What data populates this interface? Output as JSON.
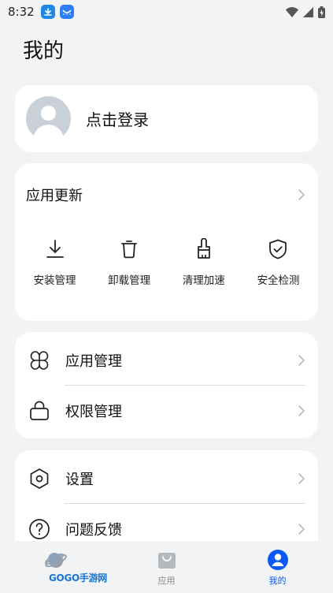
{
  "status_bar": {
    "time": "8:32",
    "icons": [
      "download-notification-icon",
      "app-store-notification-icon",
      "wifi-icon",
      "signal-icon",
      "battery-charging-icon"
    ]
  },
  "page": {
    "title": "我的"
  },
  "login": {
    "label": "点击登录",
    "icon": "default-avatar-icon"
  },
  "update": {
    "title": "应用更新",
    "tools": [
      {
        "label": "安装管理",
        "icon": "download-icon"
      },
      {
        "label": "卸载管理",
        "icon": "trash-icon"
      },
      {
        "label": "清理加速",
        "icon": "broom-icon"
      },
      {
        "label": "安全检测",
        "icon": "shield-check-icon"
      }
    ]
  },
  "manage": {
    "items": [
      {
        "label": "应用管理",
        "icon": "apps-grid-icon"
      },
      {
        "label": "权限管理",
        "icon": "lock-icon"
      }
    ]
  },
  "settings": {
    "items": [
      {
        "label": "设置",
        "icon": "settings-hexagon-icon"
      },
      {
        "label": "问题反馈",
        "icon": "help-circle-icon"
      }
    ]
  },
  "tab_bar": {
    "tabs": [
      {
        "label": "",
        "icon": "planet-icon"
      },
      {
        "label": "应用",
        "icon": "shopping-bag-icon"
      },
      {
        "label": "我的",
        "icon": "profile-icon",
        "active": true
      }
    ],
    "active_color": "#0a59f7"
  },
  "watermark": {
    "text": "GOGO手游网"
  },
  "colors": {
    "background": "#f1f3f5",
    "card": "#ffffff",
    "accent": "#0a59f7"
  }
}
